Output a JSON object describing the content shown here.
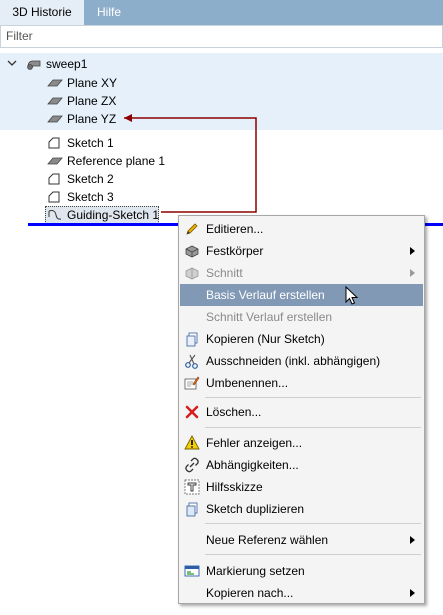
{
  "tabs": [
    {
      "label": "3D Historie",
      "active": true
    },
    {
      "label": "Hilfe",
      "active": false
    }
  ],
  "filter": {
    "placeholder": "Filter",
    "value": ""
  },
  "tree": {
    "root": {
      "label": "sweep1",
      "icon": "sweep-icon"
    },
    "planes": [
      {
        "label": "Plane XY",
        "icon": "plane-icon"
      },
      {
        "label": "Plane ZX",
        "icon": "plane-icon"
      },
      {
        "label": "Plane YZ",
        "icon": "plane-icon"
      }
    ],
    "items": [
      {
        "label": "Sketch 1",
        "icon": "sketch-icon"
      },
      {
        "label": "Reference plane 1",
        "icon": "plane-icon"
      },
      {
        "label": "Sketch 2",
        "icon": "sketch-icon"
      },
      {
        "label": "Sketch 3",
        "icon": "sketch-icon"
      },
      {
        "label": "Guiding-Sketch 1",
        "icon": "guiding-sketch-icon",
        "selected": true
      }
    ]
  },
  "context_menu": {
    "items": [
      {
        "label": "Editieren...",
        "icon": "pencil-icon",
        "enabled": true
      },
      {
        "label": "Festkörper",
        "icon": "solid-icon",
        "enabled": true,
        "submenu": true
      },
      {
        "label": "Schnitt",
        "icon": "section-icon",
        "enabled": false,
        "submenu": true
      },
      {
        "label": "Basis Verlauf erstellen",
        "enabled": true,
        "highlighted": true
      },
      {
        "label": "Schnitt Verlauf erstellen",
        "enabled": false
      },
      {
        "label": "Kopieren (Nur Sketch)",
        "icon": "copy-icon",
        "enabled": true
      },
      {
        "label": "Ausschneiden (inkl. abhängigen)",
        "icon": "scissors-icon",
        "enabled": true
      },
      {
        "label": "Umbenennen...",
        "icon": "rename-icon",
        "enabled": true
      },
      {
        "label": "Löschen...",
        "icon": "delete-icon",
        "enabled": true
      },
      {
        "label": "Fehler anzeigen...",
        "icon": "warning-icon",
        "enabled": true
      },
      {
        "label": "Abhängigkeiten...",
        "icon": "link-icon",
        "enabled": true
      },
      {
        "label": "Hilfsskizze",
        "icon": "helper-sketch-icon",
        "enabled": true
      },
      {
        "label": "Sketch duplizieren",
        "icon": "duplicate-icon",
        "enabled": true
      },
      {
        "label": "Neue Referenz wählen",
        "enabled": true,
        "submenu": true
      },
      {
        "label": "Markierung setzen",
        "icon": "marker-icon",
        "enabled": true
      },
      {
        "label": "Kopieren nach...",
        "enabled": true,
        "submenu": true
      }
    ]
  },
  "colors": {
    "tabbar": "#8daecb",
    "tree_highlight": "#e5f0fa",
    "drop_line": "#0000ff",
    "link_arrow": "#8b0000",
    "menu_highlight": "#8199b5"
  }
}
